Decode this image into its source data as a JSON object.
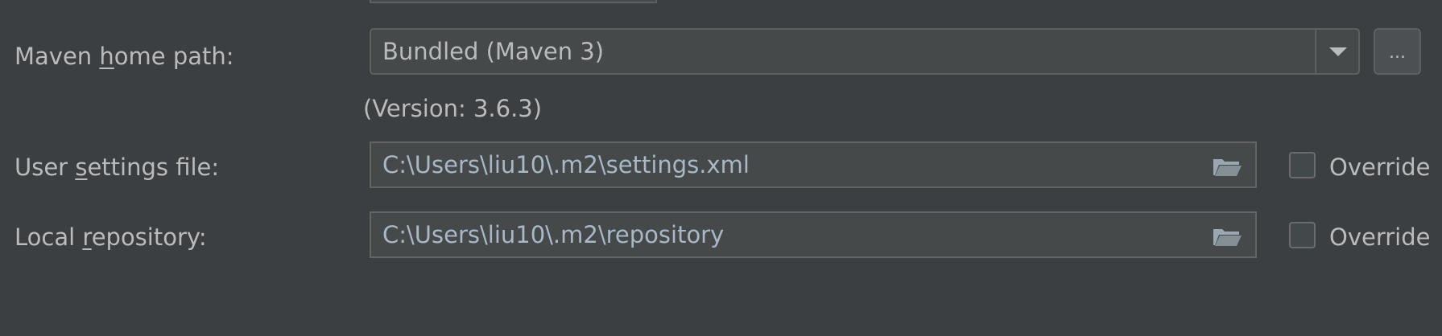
{
  "maven_home": {
    "label_pre": "Maven ",
    "label_mnemonic": "h",
    "label_post": "ome path:",
    "value": "Bundled (Maven 3)",
    "dropdown_icon": "chevron-down-icon",
    "browse_label": "...",
    "version_text": "(Version: 3.6.3)"
  },
  "user_settings": {
    "label_pre": "User ",
    "label_mnemonic": "s",
    "label_post": "ettings file:",
    "value": "C:\\Users\\liu10\\.m2\\settings.xml",
    "folder_icon": "folder-icon",
    "override_label": "Override",
    "override_checked": false
  },
  "local_repository": {
    "label_pre": "Local ",
    "label_mnemonic": "r",
    "label_post": "epository:",
    "value": "C:\\Users\\liu10\\.m2\\repository",
    "folder_icon": "folder-icon",
    "override_label": "Override",
    "override_checked": false
  },
  "colors": {
    "background": "#3c3f41",
    "field_background": "#45494a",
    "text": "#bbbbbb",
    "path_text": "#a9b7c6",
    "border": "#5e6060"
  }
}
